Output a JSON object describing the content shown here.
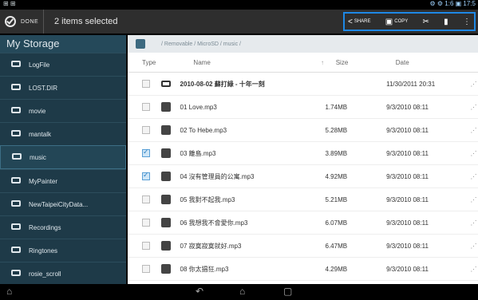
{
  "statusbar": {
    "left": "⊞ ⊞",
    "right": "⚙ ⚙ 1:6 ▣ 17:5"
  },
  "actionbar": {
    "done_label": "DONE",
    "selected_text": "2 items selected",
    "actions": [
      {
        "name": "share",
        "icon": "share-icon",
        "glyph": "<",
        "label": "SHARE"
      },
      {
        "name": "copy",
        "icon": "copy-icon",
        "glyph": "▣",
        "label": "COPY"
      },
      {
        "name": "cut",
        "icon": "cut-icon",
        "glyph": "✂",
        "label": ""
      },
      {
        "name": "delete",
        "icon": "trash-icon",
        "glyph": "▮",
        "label": ""
      },
      {
        "name": "more",
        "icon": "grid-icon",
        "glyph": "⋮",
        "label": ""
      }
    ]
  },
  "sidebar": {
    "title": "My Storage",
    "items": [
      {
        "label": "LogFile"
      },
      {
        "label": "LOST.DIR"
      },
      {
        "label": "movie"
      },
      {
        "label": "mantalk"
      },
      {
        "label": "music"
      },
      {
        "label": "MyPainter"
      },
      {
        "label": "NewTaipeiCityData..."
      },
      {
        "label": "Recordings"
      },
      {
        "label": "Ringtones"
      },
      {
        "label": "rosie_scroll"
      }
    ]
  },
  "breadcrumb": "/ Removable / MicroSD / music /",
  "table": {
    "headers": {
      "type": "Type",
      "name": "Name",
      "sort": "↑",
      "size": "Size",
      "date": "Date"
    },
    "rows": [
      {
        "selected": false,
        "kind": "folder",
        "name": "2010-08-02 蘇打綠 - 十年一刻",
        "size": "",
        "date": "11/30/2011 20:31"
      },
      {
        "selected": false,
        "kind": "music",
        "name": "01 Love.mp3",
        "size": "1.74MB",
        "date": "9/3/2010 08:11"
      },
      {
        "selected": false,
        "kind": "music",
        "name": "02 To Hebe.mp3",
        "size": "5.28MB",
        "date": "9/3/2010 08:11"
      },
      {
        "selected": true,
        "kind": "music",
        "name": "03 離島.mp3",
        "size": "3.89MB",
        "date": "9/3/2010 08:11"
      },
      {
        "selected": true,
        "kind": "music",
        "name": "04 沒有管理員的公寓.mp3",
        "size": "4.92MB",
        "date": "9/3/2010 08:11"
      },
      {
        "selected": false,
        "kind": "music",
        "name": "05 我對不起我.mp3",
        "size": "5.21MB",
        "date": "9/3/2010 08:11"
      },
      {
        "selected": false,
        "kind": "music",
        "name": "06 我想我不會愛你.mp3",
        "size": "6.07MB",
        "date": "9/3/2010 08:11"
      },
      {
        "selected": false,
        "kind": "music",
        "name": "07 寂寞寂寞就好.mp3",
        "size": "6.47MB",
        "date": "9/3/2010 08:11"
      },
      {
        "selected": false,
        "kind": "music",
        "name": "08 你太猖狂.mp3",
        "size": "4.29MB",
        "date": "9/3/2010 08:11"
      }
    ]
  },
  "navbar": {
    "home": "⌂",
    "back": "↶",
    "home2": "⌂",
    "recent": "▢"
  },
  "colors": {
    "accent": "#1e88e5",
    "sidebar_bg": "#1e3a48"
  }
}
